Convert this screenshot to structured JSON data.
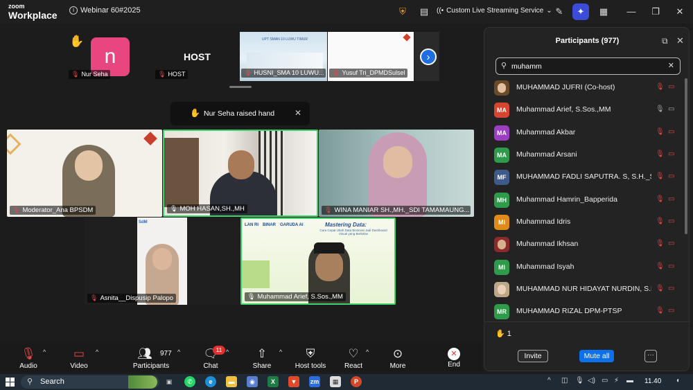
{
  "titlebar": {
    "brand_top": "zoom",
    "brand_bottom": "Workplace",
    "meeting_title": "Webinar 60#2025",
    "stream_label": "Custom Live Streaming Service"
  },
  "gallery_strip": {
    "thumbs": [
      {
        "name": "Nur Seha",
        "avatar_letter": "n",
        "avatar_color": "#e8467f"
      },
      {
        "name": "HOST",
        "display_text": "HOST"
      },
      {
        "name": "HUSNI_SMA 10 LUWU...",
        "banner": "UPT SMAN 10 LUWU TIMUR"
      },
      {
        "name": "Yusuf Tri_DPMDSulsel"
      }
    ]
  },
  "toast": {
    "text": "Nur Seha raised hand"
  },
  "videos": [
    {
      "label": "Moderator_Ana BPSDM"
    },
    {
      "label": "MOH HASAN,SH.,MH"
    },
    {
      "label": "WINA MANIAR SH.,MH._SDI TAMAMAUNG..."
    },
    {
      "label": "Asnita__Dispusip Palopo"
    },
    {
      "label": "Muhammad Arief, S.Sos.,MM",
      "slide_title": "Mastering Data:",
      "slide_subtitle": "Cara Cepat Ubah Data Birokrasi Jadi Dashboard Visual yang Berkelas",
      "logos": [
        "LAN RI",
        "BINAR",
        "GARUDA AI"
      ]
    }
  ],
  "panel": {
    "title": "Participants (977)",
    "search_value": "muhamm",
    "participants": [
      {
        "initials": "",
        "name": "MUHAMMAD JUFRI (Co-host)",
        "color": "#6b4a2a",
        "mic": "muted",
        "cam": "off"
      },
      {
        "initials": "MA",
        "name": "Muhammad Arief, S.Sos.,MM",
        "color": "#d6452f",
        "mic": "on",
        "cam": "on"
      },
      {
        "initials": "MA",
        "name": "Muhammad Akbar",
        "color": "#9b3ec4",
        "mic": "muted",
        "cam": "off"
      },
      {
        "initials": "MA",
        "name": "Muhammad Arsani",
        "color": "#2e9b4a",
        "mic": "muted",
        "cam": "off"
      },
      {
        "initials": "MF",
        "name": "MUHAMMAD FADLI SAPUTRA. S, S.H._SA...",
        "color": "#3e5a8a",
        "mic": "muted",
        "cam": "off"
      },
      {
        "initials": "MH",
        "name": "Muhammad Hamrin_Bapperida",
        "color": "#2e9b4a",
        "mic": "muted",
        "cam": "off"
      },
      {
        "initials": "MI",
        "name": "Muhammad Idris",
        "color": "#e08a1a",
        "mic": "muted",
        "cam": "off"
      },
      {
        "initials": "",
        "name": "Muhammad Ikhsan",
        "color": "#8a2a2a",
        "mic": "muted",
        "cam": "off"
      },
      {
        "initials": "MI",
        "name": "Muhammad Isyah",
        "color": "#2e9b4a",
        "mic": "muted",
        "cam": "off"
      },
      {
        "initials": "",
        "name": "MUHAMMAD NUR HIDAYAT NURDIN, S.P...",
        "color": "#bca887",
        "mic": "muted",
        "cam": "off"
      },
      {
        "initials": "MR",
        "name": "MUHAMMAD RIZAL DPM-PTSP",
        "color": "#2e9b4a",
        "mic": "muted",
        "cam": "off"
      }
    ],
    "raised_hands": "1",
    "invite_label": "Invite",
    "mute_all_label": "Mute all"
  },
  "toolbar": {
    "audio": "Audio",
    "video": "Video",
    "participants": "Participants",
    "participant_count": "977",
    "chat": "Chat",
    "chat_badge": "11",
    "share": "Share",
    "host_tools": "Host tools",
    "react": "React",
    "more": "More",
    "end": "End"
  },
  "taskbar": {
    "search": "Search",
    "time": "11.40"
  }
}
